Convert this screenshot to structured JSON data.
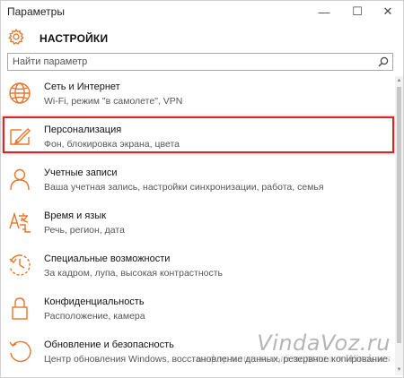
{
  "window": {
    "title": "Параметры",
    "controls": {
      "minimize": "—",
      "maximize": "☐",
      "close": "✕"
    }
  },
  "header": {
    "title": "НАСТРОЙКИ"
  },
  "search": {
    "placeholder": "Найти параметр",
    "value": ""
  },
  "colors": {
    "accent": "#e8752a",
    "highlight": "#d7262a"
  },
  "items": [
    {
      "label": "Сеть и Интернет",
      "desc": "Wi-Fi, режим \"в самолете\", VPN",
      "icon": "globe-icon"
    },
    {
      "label": "Персонализация",
      "desc": "Фон, блокировка экрана, цвета",
      "icon": "personalization-icon",
      "highlighted": true
    },
    {
      "label": "Учетные записи",
      "desc": "Ваша учетная запись, настройки синхронизации, работа, семья",
      "icon": "person-icon"
    },
    {
      "label": "Время и язык",
      "desc": "Речь, регион, дата",
      "icon": "time-language-icon"
    },
    {
      "label": "Специальные возможности",
      "desc": "За кадром, лупа, высокая контрастность",
      "icon": "accessibility-icon"
    },
    {
      "label": "Конфиденциальность",
      "desc": "Расположение, камера",
      "icon": "lock-icon"
    },
    {
      "label": "Обновление и безопасность",
      "desc": "Центр обновления Windows, восстановление данных, резервное копирование",
      "icon": "update-icon"
    }
  ],
  "watermark": {
    "name": "VindaVoz.ru",
    "subtitle": "информационный портал о Windows"
  }
}
